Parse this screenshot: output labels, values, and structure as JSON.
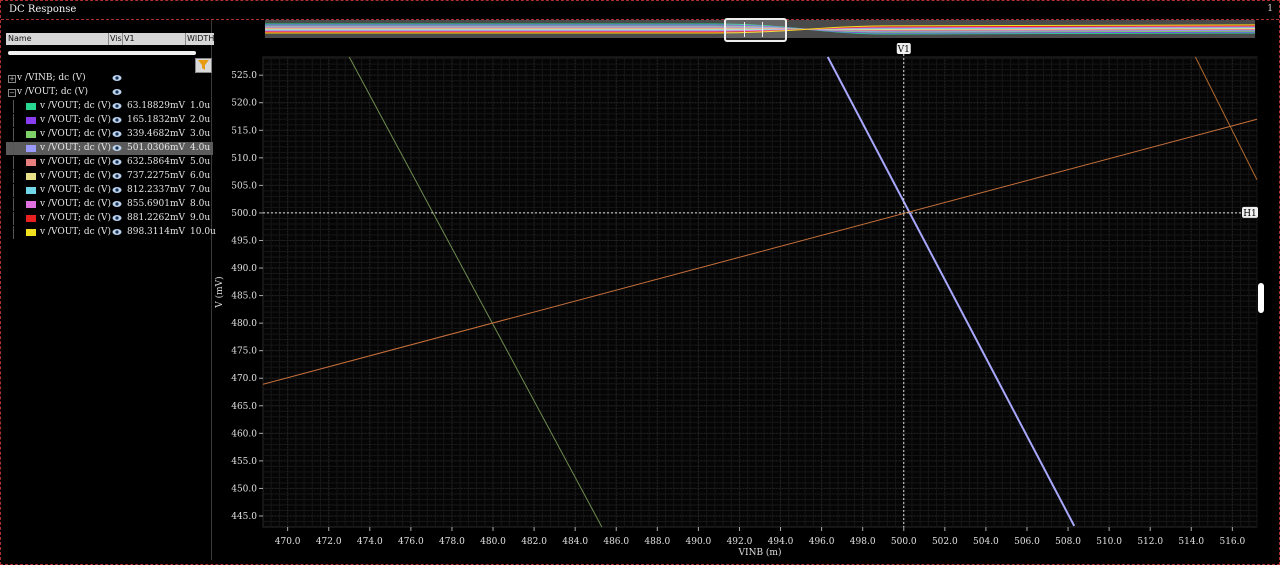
{
  "window": {
    "title": "DC Response",
    "number": "1"
  },
  "panel": {
    "columns": [
      "Name",
      "Vis",
      "V1",
      "WIDTH"
    ],
    "groups": [
      {
        "label": "v /VINB; dc (V)",
        "expanded": false
      },
      {
        "label": "v /VOUT; dc (V)",
        "expanded": true
      }
    ],
    "rows": [
      {
        "name": "v /VOUT; dc (V)",
        "v1": "63.18829mV",
        "width": "1.0u",
        "color": "#28d890"
      },
      {
        "name": "v /VOUT; dc (V)",
        "v1": "165.1832mV",
        "width": "2.0u",
        "color": "#8a3cf0"
      },
      {
        "name": "v /VOUT; dc (V)",
        "v1": "339.4682mV",
        "width": "3.0u",
        "color": "#7ed068"
      },
      {
        "name": "v /VOUT; dc (V)",
        "v1": "501.0306mV",
        "width": "4.0u",
        "color": "#9a9aff",
        "selected": true
      },
      {
        "name": "v /VOUT; dc (V)",
        "v1": "632.5864mV",
        "width": "5.0u",
        "color": "#e88080"
      },
      {
        "name": "v /VOUT; dc (V)",
        "v1": "737.2275mV",
        "width": "6.0u",
        "color": "#e8e088"
      },
      {
        "name": "v /VOUT; dc (V)",
        "v1": "812.2337mV",
        "width": "7.0u",
        "color": "#70d8e8"
      },
      {
        "name": "v /VOUT; dc (V)",
        "v1": "855.6901mV",
        "width": "8.0u",
        "color": "#e070e0"
      },
      {
        "name": "v /VOUT; dc (V)",
        "v1": "881.2262mV",
        "width": "9.0u",
        "color": "#e82020"
      },
      {
        "name": "v /VOUT; dc (V)",
        "v1": "898.3114mV",
        "width": "10.0u",
        "color": "#f0e020"
      }
    ]
  },
  "markers": {
    "vertical": "V1",
    "horizontal": "H1",
    "v1_x": 500.0,
    "h1_y": 500.0
  },
  "chart_data": {
    "type": "line",
    "xlabel": "VINB (m)",
    "ylabel": "V (mV)",
    "xlim": [
      468.8,
      517.2
    ],
    "ylim": [
      443.0,
      528.3
    ],
    "xticks": [
      470.0,
      472.0,
      474.0,
      476.0,
      478.0,
      480.0,
      482.0,
      484.0,
      486.0,
      488.0,
      490.0,
      492.0,
      494.0,
      496.0,
      498.0,
      500.0,
      502.0,
      504.0,
      506.0,
      508.0,
      510.0,
      512.0,
      514.0,
      516.0
    ],
    "yticks": [
      445.0,
      450.0,
      455.0,
      460.0,
      465.0,
      470.0,
      475.0,
      480.0,
      485.0,
      490.0,
      495.0,
      500.0,
      505.0,
      510.0,
      515.0,
      520.0,
      525.0
    ],
    "grid": true,
    "background": "#000000",
    "series": [
      {
        "color": "#6e8c50",
        "width": 1,
        "x": [
          473.0,
          485.3
        ],
        "y": [
          528.3,
          443.0
        ]
      },
      {
        "color": "#a8a8ff",
        "width": 2,
        "x": [
          496.3,
          508.3
        ],
        "y": [
          528.3,
          443.2
        ]
      },
      {
        "color": "#c8703a",
        "width": 1,
        "x": [
          468.8,
          517.2
        ],
        "y": [
          468.9,
          517.0
        ]
      },
      {
        "color": "#b06a30",
        "width": 1,
        "x": [
          514.2,
          517.2
        ],
        "y": [
          528.3,
          506.0
        ]
      }
    ]
  }
}
